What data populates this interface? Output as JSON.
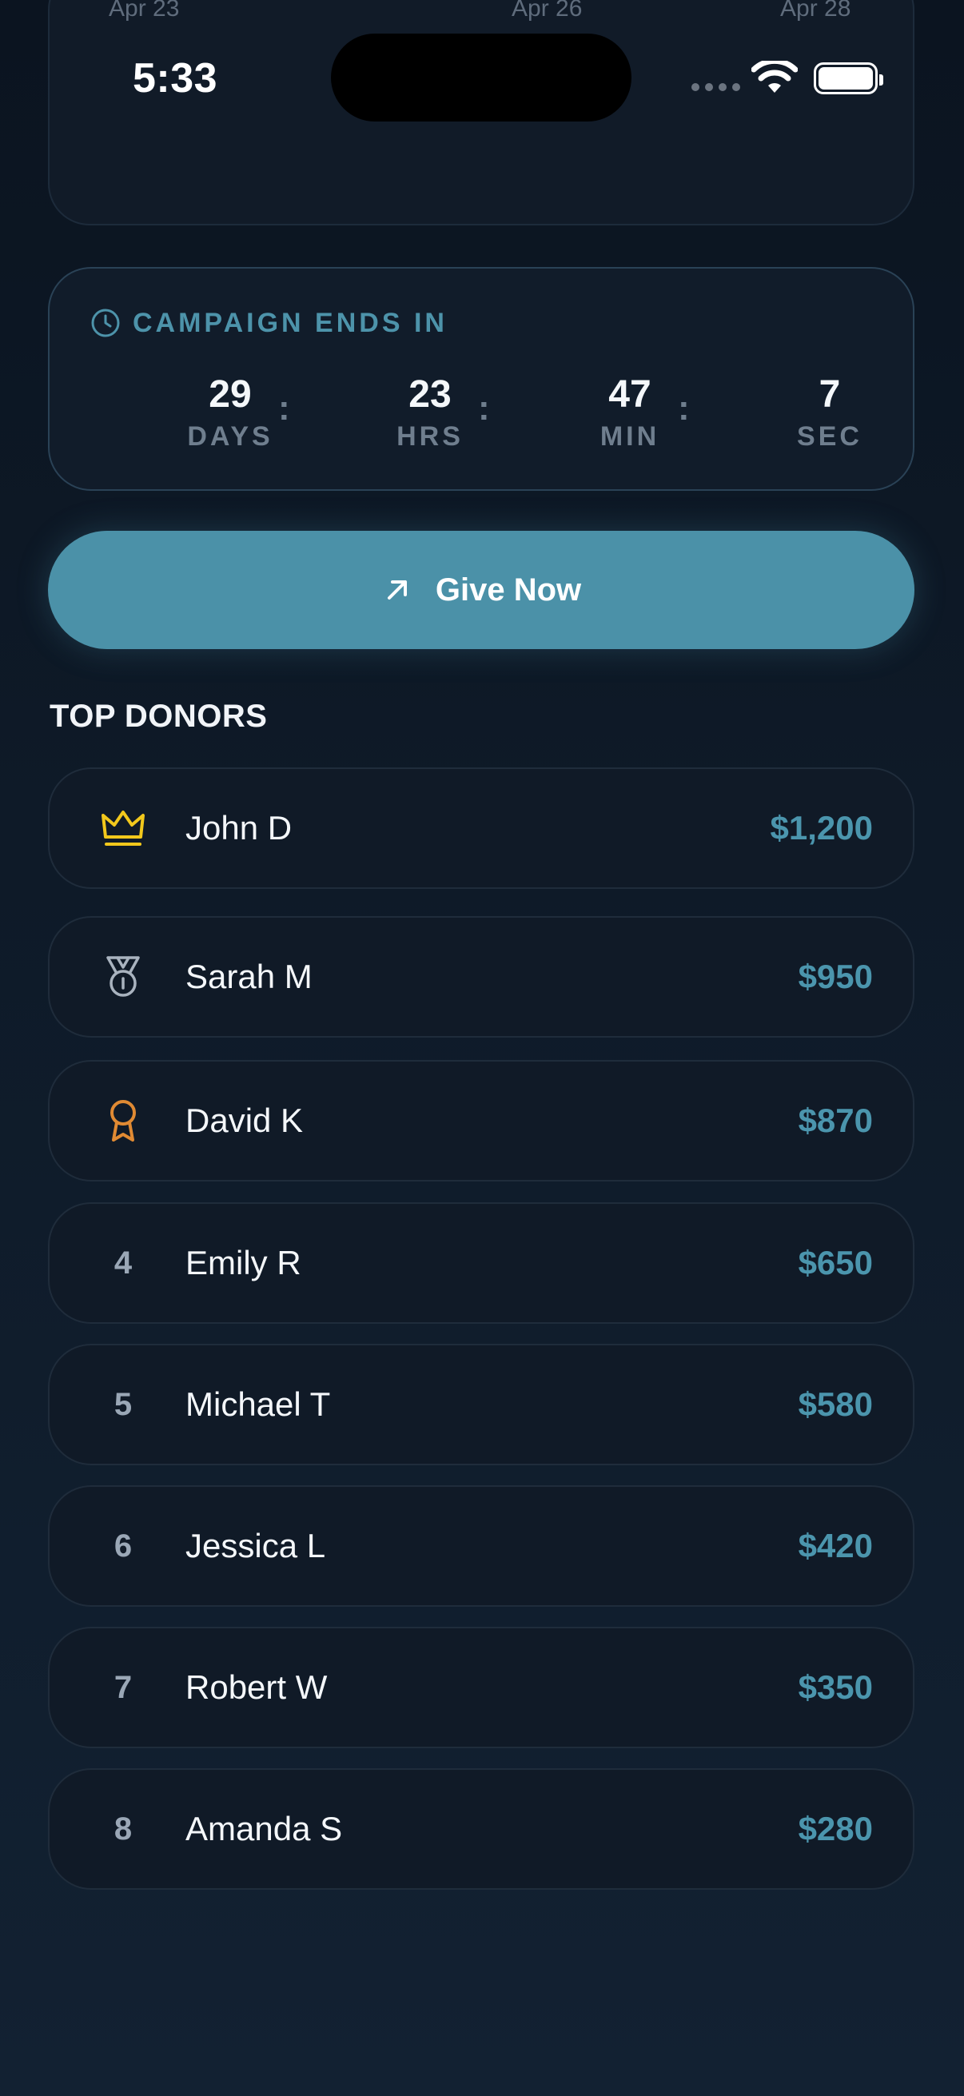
{
  "chart_axis": {
    "labels": [
      "Apr 23",
      "Apr 26",
      "Apr 28"
    ]
  },
  "status_bar": {
    "time": "5:33"
  },
  "countdown": {
    "title": "CAMPAIGN ENDS IN",
    "units": [
      {
        "value": "29",
        "label": "DAYS"
      },
      {
        "value": "23",
        "label": "HRS"
      },
      {
        "value": "47",
        "label": "MIN"
      },
      {
        "value": "7",
        "label": "SEC"
      }
    ],
    "separator": ":"
  },
  "give_button": {
    "label": "Give Now",
    "color": "#4b91a8"
  },
  "top_donors": {
    "title": "TOP DONORS",
    "items": [
      {
        "rank": "",
        "icon": "crown-icon",
        "name": "John D",
        "amount": "$1,200"
      },
      {
        "rank": "",
        "icon": "silver-medal-icon",
        "name": "Sarah M",
        "amount": "$950"
      },
      {
        "rank": "",
        "icon": "bronze-award-icon",
        "name": "David K",
        "amount": "$870"
      },
      {
        "rank": "4",
        "icon": "",
        "name": "Emily R",
        "amount": "$650"
      },
      {
        "rank": "5",
        "icon": "",
        "name": "Michael T",
        "amount": "$580"
      },
      {
        "rank": "6",
        "icon": "",
        "name": "Jessica L",
        "amount": "$420"
      },
      {
        "rank": "7",
        "icon": "",
        "name": "Robert W",
        "amount": "$350"
      },
      {
        "rank": "8",
        "icon": "",
        "name": "Amanda S",
        "amount": "$280"
      }
    ]
  },
  "colors": {
    "accent": "#4b95ad",
    "gold": "#f2c81c",
    "silver": "#a9b3bf",
    "bronze": "#e08a33"
  }
}
